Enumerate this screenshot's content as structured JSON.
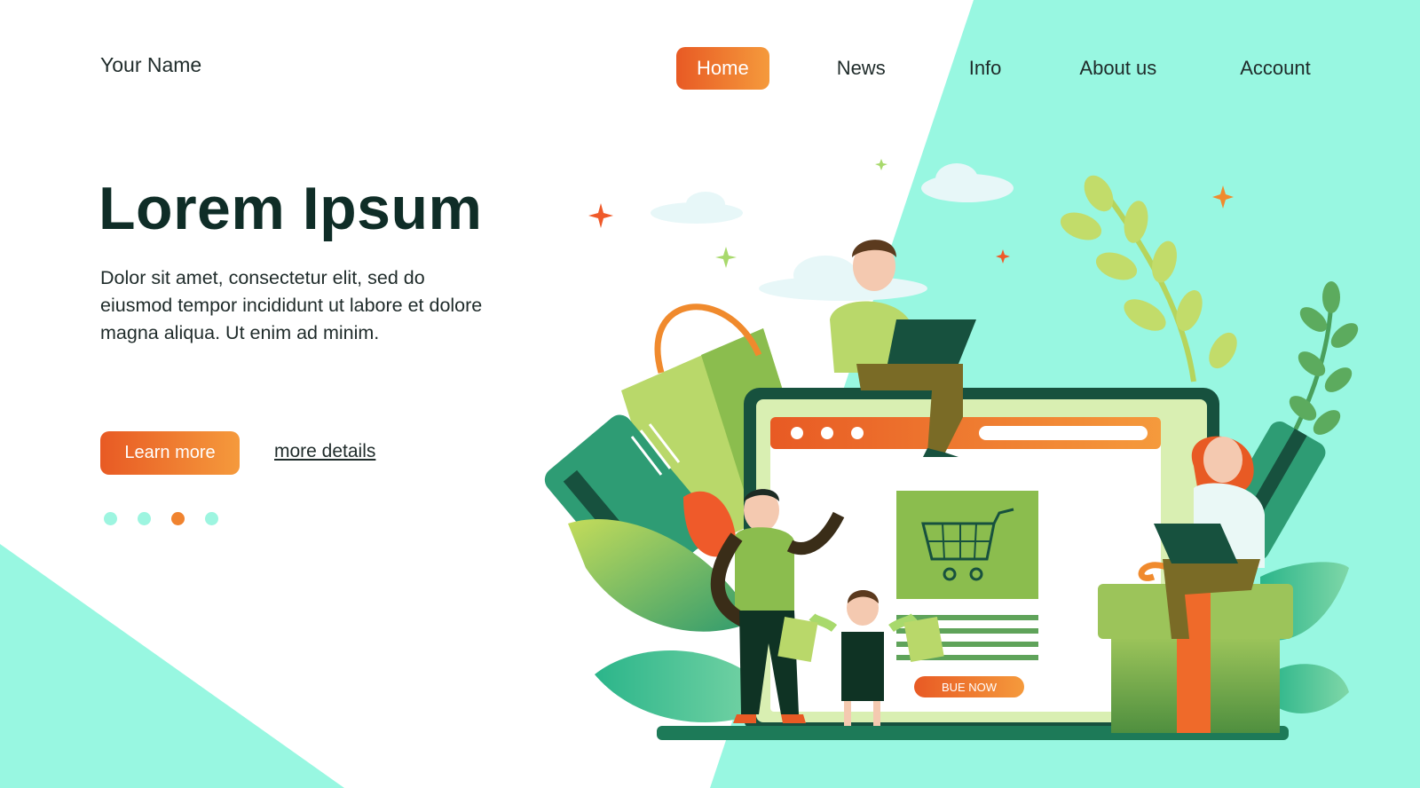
{
  "colors": {
    "accent_gradient_start": "#e85a24",
    "accent_gradient_end": "#f59a3c",
    "mint": "#98f7e1",
    "dark_green": "#0f2d27",
    "text": "#1f2b2a"
  },
  "header": {
    "brand": "Your Name",
    "nav": [
      {
        "label": "Home",
        "active": true
      },
      {
        "label": "News",
        "active": false
      },
      {
        "label": "Info",
        "active": false
      },
      {
        "label": "About us",
        "active": false
      },
      {
        "label": "Account",
        "active": false
      }
    ]
  },
  "hero": {
    "title": "Lorem Ipsum",
    "text": "Dolor sit amet, consectetur  elit, sed do eiusmod tempor incididunt ut labore et dolore magna aliqua. Ut enim ad minim.",
    "primary_button": "Learn more",
    "secondary_link": "more details",
    "carousel": {
      "count": 4,
      "active_index": 2
    }
  },
  "illustration": {
    "screen_button": "BUE NOW",
    "icons": [
      "shopping-cart-icon",
      "shopping-bag-icon",
      "credit-card-icon",
      "gift-box-icon",
      "laptop-icon"
    ]
  }
}
